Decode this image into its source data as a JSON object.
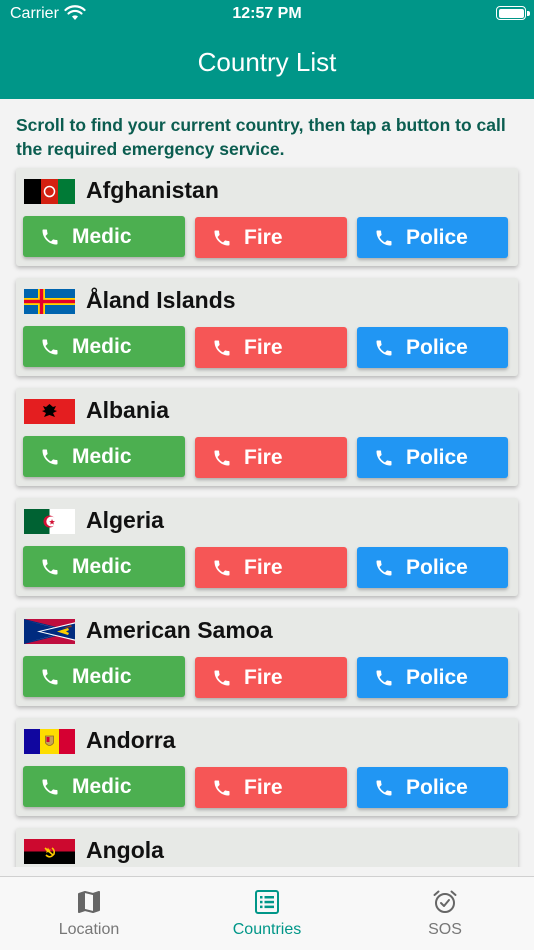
{
  "status_bar": {
    "carrier": "Carrier",
    "time": "12:57 PM"
  },
  "header": {
    "title": "Country List"
  },
  "instructions": "Scroll to find your current country, then tap a button to call the required emergency service.",
  "buttons": {
    "medic": "Medic",
    "fire": "Fire",
    "police": "Police"
  },
  "countries": [
    {
      "name": "Afghanistan",
      "flag": "afghanistan-flag"
    },
    {
      "name": "Åland Islands",
      "flag": "aland-islands-flag"
    },
    {
      "name": "Albania",
      "flag": "albania-flag"
    },
    {
      "name": "Algeria",
      "flag": "algeria-flag"
    },
    {
      "name": "American Samoa",
      "flag": "american-samoa-flag"
    },
    {
      "name": "Andorra",
      "flag": "andorra-flag"
    },
    {
      "name": "Angola",
      "flag": "angola-flag"
    }
  ],
  "tabs": [
    {
      "label": "Location",
      "icon": "map-icon",
      "active": false
    },
    {
      "label": "Countries",
      "icon": "list-icon",
      "active": true
    },
    {
      "label": "SOS",
      "icon": "alarm-clock-icon",
      "active": false
    }
  ],
  "colors": {
    "header": "#009688",
    "medic": "#4caf50",
    "fire": "#f65656",
    "police": "#2196f3",
    "instructions_text": "#0b5d50",
    "active_tab": "#009688"
  }
}
